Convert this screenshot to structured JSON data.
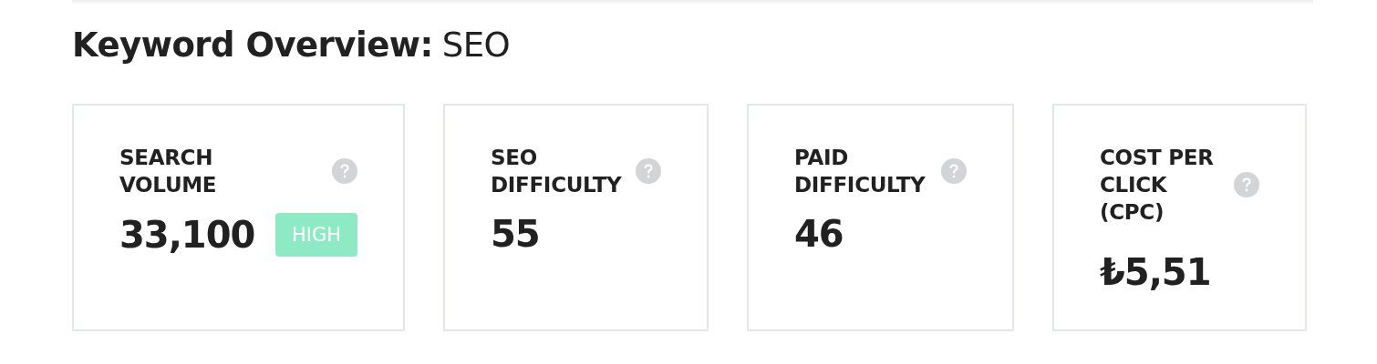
{
  "heading": {
    "title": "Keyword Overview:",
    "keyword": "SEO"
  },
  "metrics": [
    {
      "label": "SEARCH\nVOLUME",
      "value": "33,100",
      "badge": {
        "text": "HIGH",
        "color": "#8eeac4"
      }
    },
    {
      "label": "SEO\nDIFFICULTY",
      "value": "55"
    },
    {
      "label": "PAID\nDIFFICULTY",
      "value": "46"
    },
    {
      "label": "COST PER\nCLICK\n(CPC)",
      "value": "₺5,51"
    }
  ]
}
